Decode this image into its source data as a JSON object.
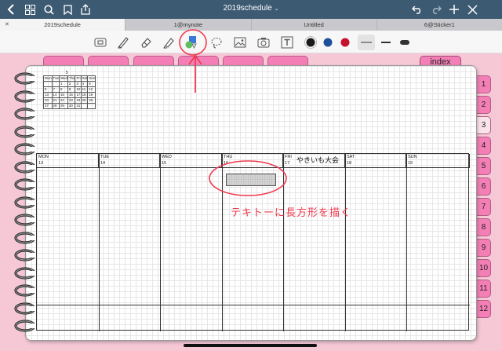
{
  "top_bar": {
    "title": "2019schedule",
    "title_chevron": "chevron-down-icon",
    "left_icons": [
      "back-chevron-icon",
      "grid-icon",
      "search-icon",
      "bookmark-icon",
      "share-icon"
    ],
    "right_icons": [
      "undo-icon",
      "redo-icon",
      "add-icon",
      "tools-icon"
    ],
    "background": "#3d5a73"
  },
  "tabs": [
    {
      "label": "2019schedule",
      "active": true
    },
    {
      "label": "1@mynote",
      "active": false
    },
    {
      "label": "Untitled",
      "active": false
    },
    {
      "label": "6@Sticker1",
      "active": false
    }
  ],
  "toolbar": {
    "tools": [
      "reading-mode-icon",
      "pen-icon",
      "eraser-icon",
      "highlighter-icon",
      "shapes-icon",
      "lasso-icon",
      "image-icon",
      "camera-icon",
      "text-icon"
    ],
    "selected_tool": "shapes-icon",
    "colors": [
      "#1a1a1a",
      "#1f4f9a",
      "#c8102e"
    ],
    "stroke_sizes": [
      "thin",
      "medium",
      "thick"
    ]
  },
  "notebook": {
    "index_tab": "index",
    "side_tabs": [
      "1",
      "2",
      "3",
      "4",
      "5",
      "6",
      "7",
      "8",
      "9",
      "10",
      "11",
      "12"
    ],
    "side_tab_color": "#f47fb6",
    "active_side_tab": "3",
    "mini_calendar": {
      "month": "5",
      "weekday_labels": [
        "Mon",
        "Tue",
        "Wed",
        "Thu",
        "Fri",
        "Sat",
        "Sun"
      ],
      "rows": [
        [
          "",
          "",
          "1",
          "2",
          "3",
          "4",
          "5"
        ],
        [
          "6",
          "7",
          "8",
          "9",
          "10",
          "11",
          "12"
        ],
        [
          "13",
          "14",
          "15",
          "16",
          "17",
          "18",
          "19"
        ],
        [
          "20",
          "21",
          "22",
          "23",
          "24",
          "25",
          "26"
        ],
        [
          "27",
          "28",
          "29",
          "30",
          "31",
          "",
          ""
        ]
      ]
    },
    "week": [
      {
        "day": "MON",
        "date": "13"
      },
      {
        "day": "TUE",
        "date": "14"
      },
      {
        "day": "WED",
        "date": "15"
      },
      {
        "day": "THU",
        "date": "16"
      },
      {
        "day": "FRI",
        "date": "17"
      },
      {
        "day": "SAT",
        "date": "18"
      },
      {
        "day": "SUN",
        "date": "19"
      }
    ],
    "handwritten_note": "やきいも大会",
    "annotation_text": "テキトーに長方形を描く",
    "annotation_color": "#f0394e"
  }
}
